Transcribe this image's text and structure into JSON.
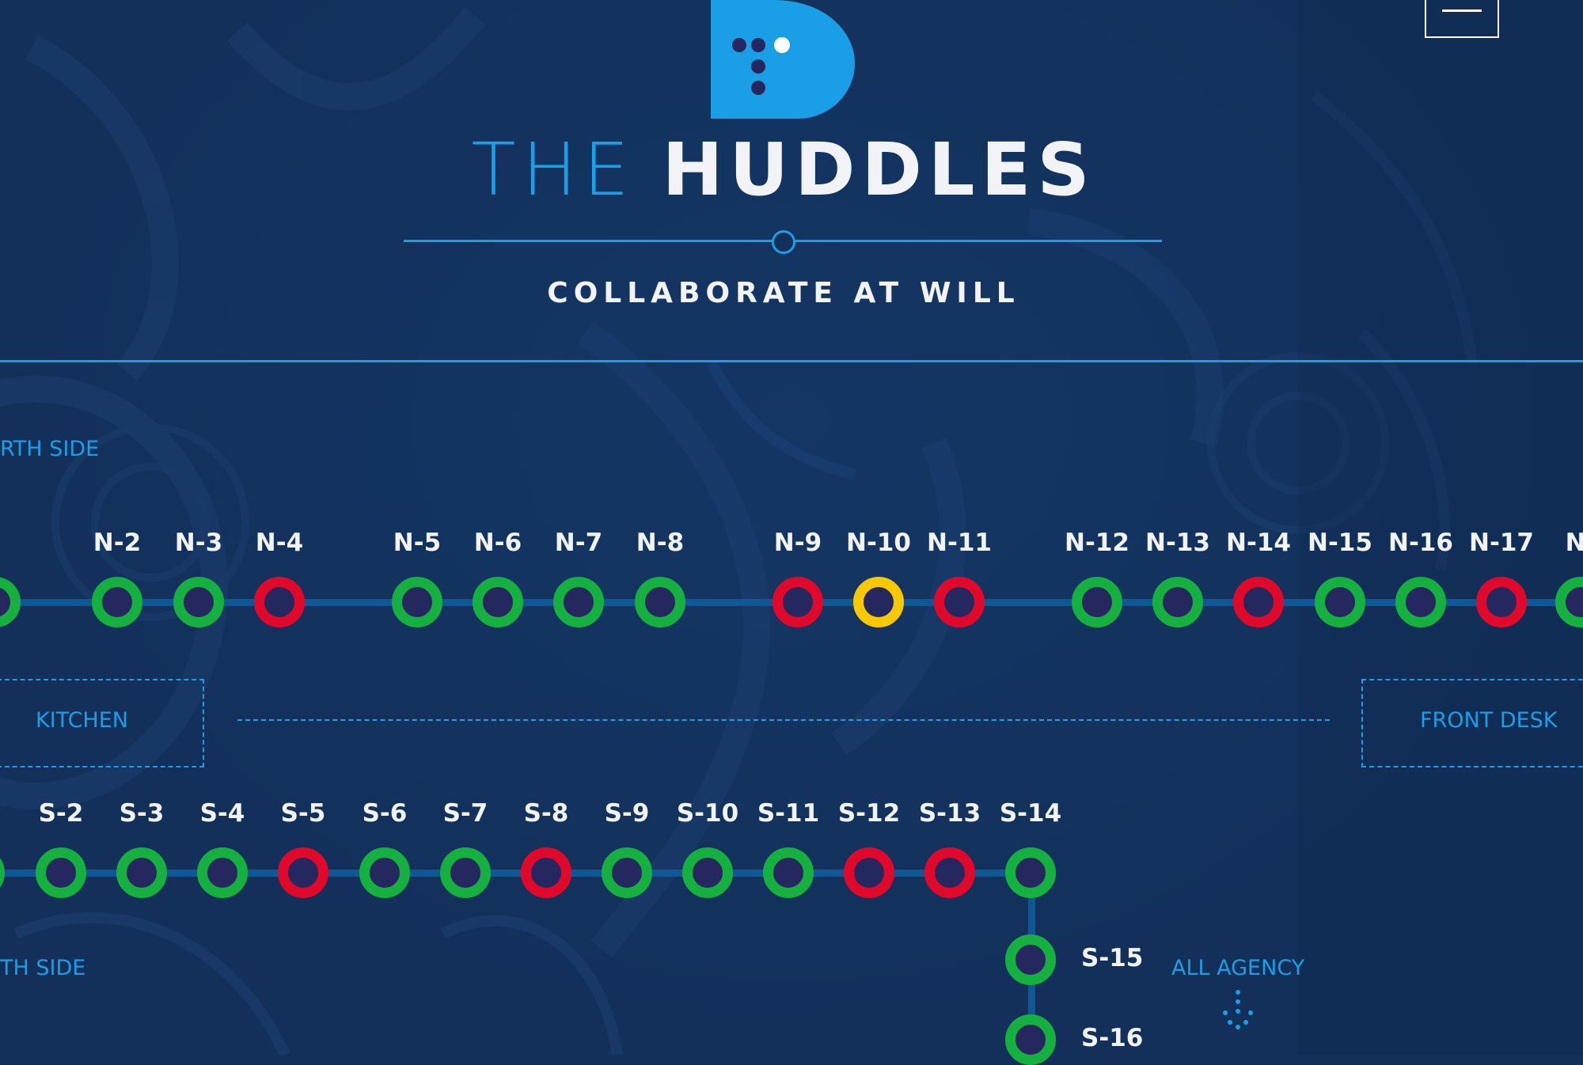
{
  "brand": {
    "title_light": "THE",
    "title_bold": "HUDDLES",
    "tagline": "COLLABORATE AT WILL",
    "colors": {
      "background": "#12305a",
      "accent": "#1a9fe6",
      "available": "#15b040",
      "occupied": "#e0092c",
      "reserved": "#f8c800",
      "room_center": "#25285e"
    }
  },
  "menu": {
    "icon": "hamburger-menu-icon"
  },
  "north": {
    "side_label": "RTH SIDE",
    "huddles": [
      {
        "label": "N-2",
        "status": "green"
      },
      {
        "label": "N-3",
        "status": "green"
      },
      {
        "label": "N-4",
        "status": "red"
      },
      {
        "label": "N-5",
        "status": "green"
      },
      {
        "label": "N-6",
        "status": "green"
      },
      {
        "label": "N-7",
        "status": "green"
      },
      {
        "label": "N-8",
        "status": "green"
      },
      {
        "label": "N-9",
        "status": "red"
      },
      {
        "label": "N-10",
        "status": "yellow"
      },
      {
        "label": "N-11",
        "status": "red"
      },
      {
        "label": "N-12",
        "status": "green"
      },
      {
        "label": "N-13",
        "status": "green"
      },
      {
        "label": "N-14",
        "status": "red"
      },
      {
        "label": "N-15",
        "status": "green"
      },
      {
        "label": "N-16",
        "status": "green"
      },
      {
        "label": "N-17",
        "status": "red"
      },
      {
        "label": "N-",
        "status": "green"
      }
    ]
  },
  "zones": {
    "kitchen": "KITCHEN",
    "front_desk": "FRONT DESK",
    "all_agency": "ALL AGENCY"
  },
  "south": {
    "side_label": "TH SIDE",
    "huddles": [
      {
        "label": "S-2",
        "status": "green"
      },
      {
        "label": "S-3",
        "status": "green"
      },
      {
        "label": "S-4",
        "status": "green"
      },
      {
        "label": "S-5",
        "status": "red"
      },
      {
        "label": "S-6",
        "status": "green"
      },
      {
        "label": "S-7",
        "status": "green"
      },
      {
        "label": "S-8",
        "status": "red"
      },
      {
        "label": "S-9",
        "status": "green"
      },
      {
        "label": "S-10",
        "status": "green"
      },
      {
        "label": "S-11",
        "status": "green"
      },
      {
        "label": "S-12",
        "status": "red"
      },
      {
        "label": "S-13",
        "status": "red"
      },
      {
        "label": "S-14",
        "status": "green"
      }
    ],
    "branch": [
      {
        "label": "S-15",
        "status": "green"
      },
      {
        "label": "S-16",
        "status": "green"
      }
    ]
  }
}
